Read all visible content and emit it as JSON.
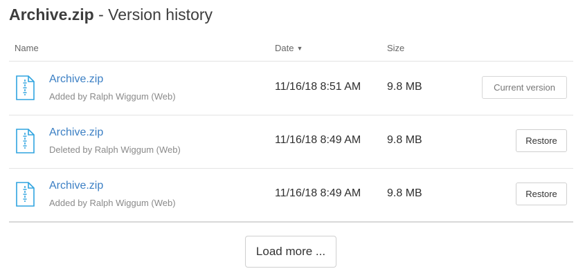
{
  "header": {
    "file_name": "Archive.zip",
    "separator": " - ",
    "title_rest": "Version history"
  },
  "columns": {
    "name": "Name",
    "date": "Date",
    "date_sort_icon": "caret-down-icon",
    "size": "Size"
  },
  "versions": [
    {
      "name": "Archive.zip",
      "subtitle": "Added by Ralph Wiggum (Web)",
      "date": "11/16/18 8:51 AM",
      "size": "9.8 MB",
      "action": "Current version",
      "icon": "zip-file-icon"
    },
    {
      "name": "Archive.zip",
      "subtitle": "Deleted by Ralph Wiggum (Web)",
      "date": "11/16/18 8:49 AM",
      "size": "9.8 MB",
      "action": "Restore",
      "icon": "zip-file-icon"
    },
    {
      "name": "Archive.zip",
      "subtitle": "Added by Ralph Wiggum (Web)",
      "date": "11/16/18 8:49 AM",
      "size": "9.8 MB",
      "action": "Restore",
      "icon": "zip-file-icon"
    }
  ],
  "load_more_label": "Load more ...",
  "colors": {
    "link": "#3b7fc4",
    "icon_blue": "#2fa3df",
    "divider": "#e3e3e3"
  }
}
